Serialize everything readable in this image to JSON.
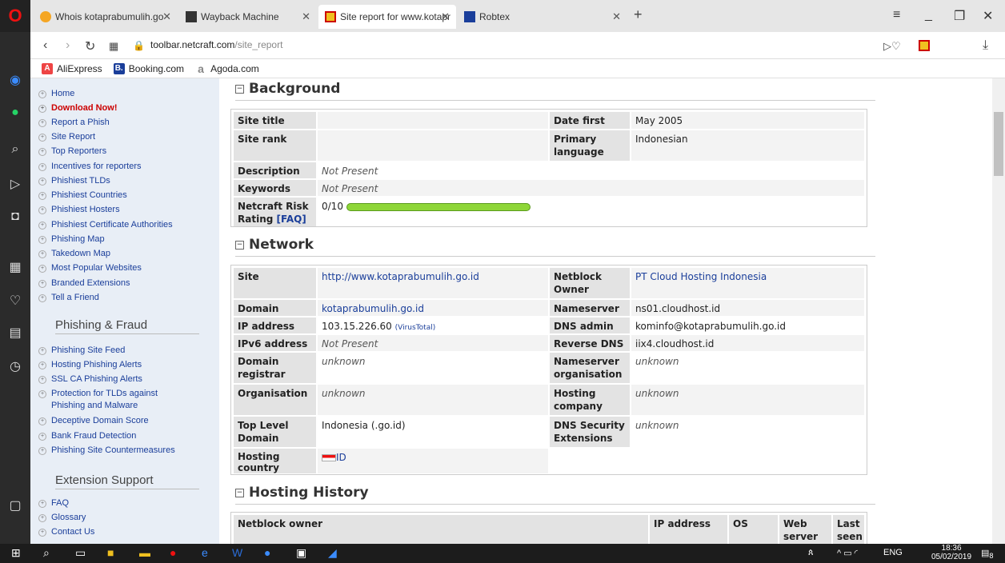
{
  "browser": {
    "tabs": [
      {
        "title": "Whois kotaprabumulih.go",
        "favicon": "whois-icon"
      },
      {
        "title": "Wayback Machine",
        "favicon": "wayback-icon"
      },
      {
        "title": "Site report for www.kotapr",
        "favicon": "netcraft-icon"
      },
      {
        "title": "Robtex",
        "favicon": "robtex-icon"
      }
    ],
    "url_host": "toolbar.netcraft.com",
    "url_path": "/site_report",
    "bookmarks": [
      {
        "label": "AliExpress",
        "badge": "A",
        "color": "#e44"
      },
      {
        "label": "Booking.com",
        "badge": "B.",
        "color": "#1a3e9a"
      },
      {
        "label": "Agoda.com",
        "badge": "a",
        "color": "#888"
      }
    ]
  },
  "leftnav": {
    "items": [
      "Home",
      "Download Now!",
      "Report a Phish",
      "Site Report",
      "Top Reporters",
      "Incentives for reporters",
      "Phishiest TLDs",
      "Phishiest Countries",
      "Phishiest Hosters",
      "Phishiest Certificate Authorities",
      "Phishing Map",
      "Takedown Map",
      "Most Popular Websites",
      "Branded Extensions",
      "Tell a Friend"
    ],
    "phishing_heading": "Phishing & Fraud",
    "phishing_items": [
      "Phishing Site Feed",
      "Hosting Phishing Alerts",
      "SSL CA Phishing Alerts",
      "Protection for TLDs against Phishing and Malware",
      "Deceptive Domain Score",
      "Bank Fraud Detection",
      "Phishing Site Countermeasures"
    ],
    "support_heading": "Extension Support",
    "support_items": [
      "FAQ",
      "Glossary",
      "Contact Us"
    ]
  },
  "background": {
    "heading": "Background",
    "site_title_label": "Site title",
    "site_title": "",
    "date_first_seen_label": "Date first seen",
    "date_first_seen": "May 2005",
    "site_rank_label": "Site rank",
    "site_rank": "",
    "primary_language_label": "Primary language",
    "primary_language": "Indonesian",
    "description_label": "Description",
    "description": "Not Present",
    "keywords_label": "Keywords",
    "keywords": "Not Present",
    "risk_label": "Netcraft Risk Rating",
    "risk_faq": "[FAQ]",
    "risk_value": "0/10"
  },
  "network": {
    "heading": "Network",
    "site_label": "Site",
    "site": "http://www.kotaprabumulih.go.id",
    "netblock_owner_label": "Netblock Owner",
    "netblock_owner": "PT Cloud Hosting Indonesia",
    "domain_label": "Domain",
    "domain": "kotaprabumulih.go.id",
    "nameserver_label": "Nameserver",
    "nameserver": "ns01.cloudhost.id",
    "ip_label": "IP address",
    "ip": "103.15.226.60",
    "virustotal": "(VirusTotal)",
    "dns_admin_label": "DNS admin",
    "dns_admin": "kominfo@kotaprabumulih.go.id",
    "ipv6_label": "IPv6 address",
    "ipv6": "Not Present",
    "reverse_dns_label": "Reverse DNS",
    "reverse_dns": "iix4.cloudhost.id",
    "registrar_label": "Domain registrar",
    "registrar": "unknown",
    "ns_org_label": "Nameserver organisation",
    "ns_org": "unknown",
    "organisation_label": "Organisation",
    "organisation": "unknown",
    "hosting_company_label": "Hosting company",
    "hosting_company": "unknown",
    "tld_label": "Top Level Domain",
    "tld": "Indonesia (.go.id)",
    "dnssec_label": "DNS Security Extensions",
    "dnssec": "unknown",
    "hosting_country_label": "Hosting country",
    "hosting_country": "ID"
  },
  "hosting_history": {
    "heading": "Hosting History",
    "columns": [
      "Netblock owner",
      "IP address",
      "OS",
      "Web server",
      "Last seen"
    ]
  },
  "taskbar": {
    "time": "18:36",
    "date": "05/02/2019",
    "lang": "ENG",
    "notif": "8"
  }
}
